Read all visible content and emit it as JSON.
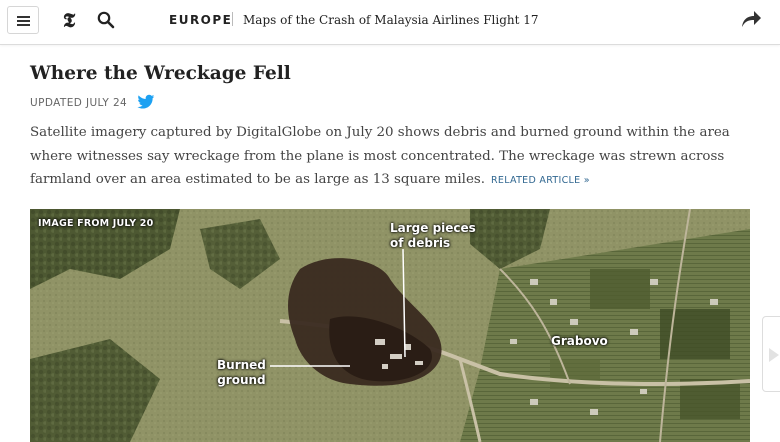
{
  "topbar": {
    "menu_icon": "hamburger-menu-icon",
    "logo_icon": "nyt-logo-icon",
    "search_icon": "search-icon",
    "section": "EUROPE",
    "headline": "Maps of the Crash of Malaysia Airlines Flight 17",
    "share_icon": "share-arrow-icon"
  },
  "article": {
    "title": "Where the Wreckage Fell",
    "updated": "UPDATED JULY 24",
    "twitter_icon": "twitter-bird-icon",
    "summary": "Satellite imagery captured by DigitalGlobe on July 20 shows debris and burned ground within the area where witnesses say wreckage from the plane is most concentrated. The wreckage was strewn across farmland over an area estimated to be as large as 13 square miles.",
    "related": "RELATED ARTICLE »"
  },
  "map": {
    "date_label": "IMAGE FROM JULY 20",
    "debris_label": "Large pieces\nof debris",
    "burned_label": "Burned\nground",
    "village_label": "Grabovo"
  },
  "nav": {
    "next_icon": "chevron-right-icon"
  },
  "colors": {
    "link": "#326891",
    "twitter": "#1da1f2"
  }
}
